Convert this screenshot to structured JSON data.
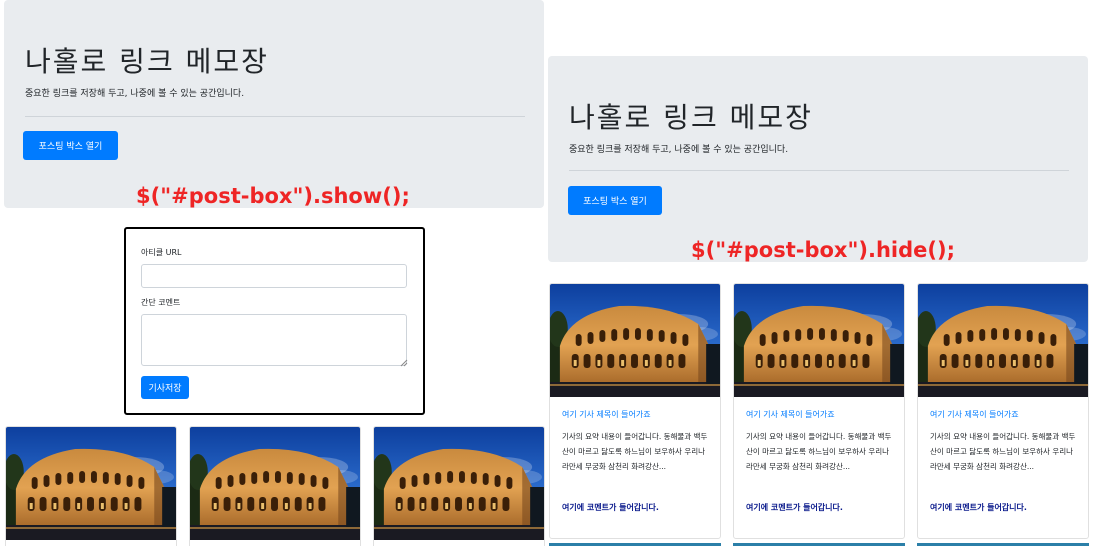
{
  "jumbotron": {
    "title": "나홀로 링크 메모장",
    "lead": "중요한 링크를 저장해 두고, 나중에 볼 수 있는 공간입니다.",
    "open_button": "포스팅 박스 열기"
  },
  "annotations": {
    "show": "$(\"#post-box\").show();",
    "hide": "$(\"#post-box\").hide();"
  },
  "post_box": {
    "url_label": "아티클 URL",
    "comment_label": "간단 코멘트",
    "url_value": "",
    "comment_value": "",
    "save_button": "기사저장"
  },
  "cards": [
    {
      "title": "여기 기사 제목이 들어가죠",
      "text": "기사의 요약 내용이 들어갑니다. 동해물과 백두산이 마르고 닳도록 하느님이 보우하사 우리나라만세 무궁화 삼천리 화려강산...",
      "comment": "여기에 코멘트가 들어갑니다."
    },
    {
      "title": "여기 기사 제목이 들어가죠",
      "text": "기사의 요약 내용이 들어갑니다. 동해물과 백두산이 마르고 닳도록 하느님이 보우하사 우리나라만세 무궁화 삼천리 화려강산...",
      "comment": "여기에 코멘트가 들어갑니다."
    },
    {
      "title": "여기 기사 제목이 들어가죠",
      "text": "기사의 요약 내용이 들어갑니다. 동해물과 백두산이 마르고 닳도록 하느님이 보우하사 우리나라만세 무궁화 삼천리 화려강산...",
      "comment": "여기에 코멘트가 들어갑니다."
    }
  ],
  "colors": {
    "primary": "#007bff",
    "jumbotron_bg": "#e9ecef",
    "annotation": "#ee2525",
    "comment": "#0a1a8c"
  },
  "icons": {
    "card_image": "colosseum-image",
    "textarea_grip": "resize-grip-icon"
  }
}
